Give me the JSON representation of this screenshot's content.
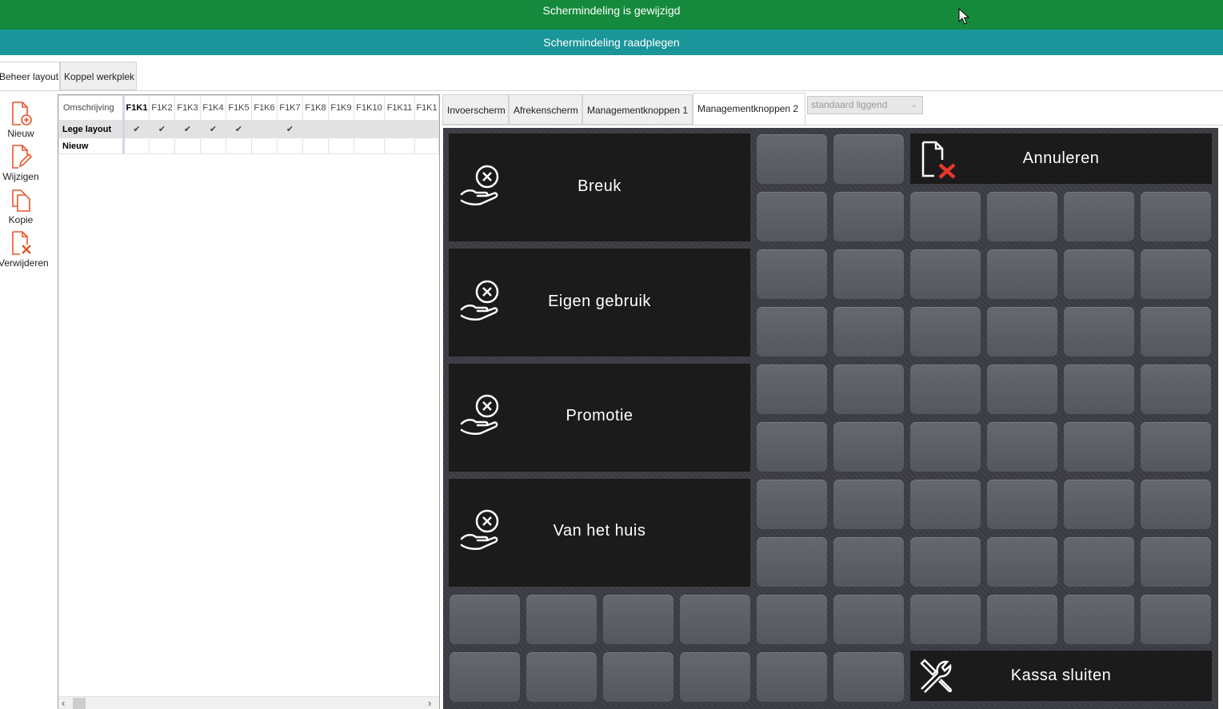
{
  "banner": {
    "changed": "Schermindeling is gewijzigd",
    "view": "Schermindeling raadplegen"
  },
  "main_tabs": [
    {
      "label": "Beheer layout",
      "active": true
    },
    {
      "label": "Koppel werkplek",
      "active": false
    }
  ],
  "toolbar": {
    "new": "Nieuw",
    "edit": "Wijzigen",
    "copy": "Kopie",
    "delete": "Verwijderen"
  },
  "grid": {
    "columns": [
      "Omschrijving",
      "F1K1",
      "F1K2",
      "F1K3",
      "F1K4",
      "F1K5",
      "F1K6",
      "F1K7",
      "F1K8",
      "F1K9",
      "F1K10",
      "F1K11",
      "F1K1"
    ],
    "rows": [
      {
        "name": "Lege layout",
        "checks": [
          true,
          true,
          true,
          true,
          true,
          false,
          true,
          false,
          false,
          false,
          false,
          false
        ]
      },
      {
        "name": "Nieuw",
        "checks": [
          false,
          false,
          false,
          false,
          false,
          false,
          false,
          false,
          false,
          false,
          false,
          false
        ]
      }
    ],
    "check_glyph": "✔",
    "scroll_left": "‹",
    "scroll_right": "›"
  },
  "screen_tabs": [
    {
      "label": "Invoerscherm",
      "active": false
    },
    {
      "label": "Afrekenscherm",
      "active": false
    },
    {
      "label": "Managementknoppen 1",
      "active": false
    },
    {
      "label": "Managementknoppen 2",
      "active": true
    }
  ],
  "layout_select": {
    "value": "standaard liggend",
    "arrow": "⌄"
  },
  "pos_buttons": {
    "breuk": "Breuk",
    "eigen_gebruik": "Eigen gebruik",
    "promotie": "Promotie",
    "van_het_huis": "Van het huis",
    "annuleren": "Annuleren",
    "kassa_sluiten": "Kassa sluiten"
  },
  "icons": {
    "toolbar": [
      "doc-plus-icon",
      "doc-edit-icon",
      "doc-copy-icon",
      "doc-delete-icon"
    ],
    "pos": [
      "hand-cancel-icon",
      "doc-cancel-icon",
      "tools-icon"
    ],
    "accent": "#e8552a",
    "banner_green": "#158a3c",
    "banner_teal": "#1a9599"
  }
}
